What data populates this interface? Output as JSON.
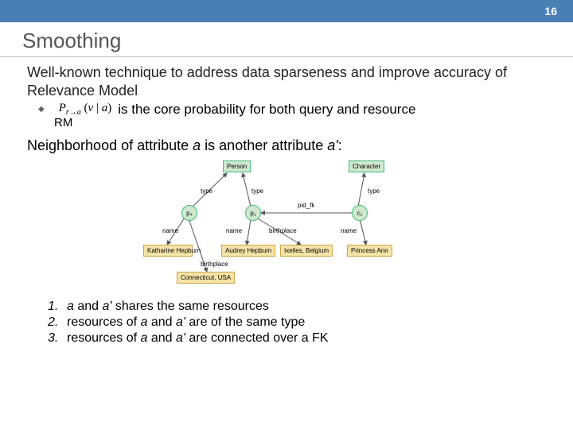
{
  "page_number": "16",
  "title": "Smoothing",
  "intro": "Well-known technique to address data sparseness and improve accuracy of Relevance Model",
  "core_prob_text": " is the core probability for both query and resource",
  "rm_label": "RM",
  "formula_html": "P<sub>r→a</sub> (v | a)",
  "section2": "Neighborhood of attribute a is another attribute a':",
  "diagram": {
    "person": "Person",
    "character": "Character",
    "p4": "p₄",
    "p1": "p₁",
    "c1": "c₁",
    "kath": "Katharine Hepburn",
    "audrey": "Audrey Hepburn",
    "ixelles": "Ixelles, Belgium",
    "princess": "Princess Ann",
    "conn": "Connecticut, USA",
    "lbl_type": "type",
    "lbl_name": "name",
    "lbl_pidfk": "pid_fk",
    "lbl_birthplace": "birthplace"
  },
  "rules": [
    {
      "n": "1.",
      "text_a": "a",
      "mid1": " and ",
      "text_ap": "a'",
      "rest": " shares the same resources"
    },
    {
      "n": "2.",
      "pre": "resources of ",
      "text_a": "a",
      "mid1": " and ",
      "text_ap": "a'",
      "rest": " are of the same type"
    },
    {
      "n": "3.",
      "pre": "resources of ",
      "text_a": "a",
      "mid1": " and ",
      "text_ap": "a'",
      "rest": " are connected over a FK"
    }
  ]
}
